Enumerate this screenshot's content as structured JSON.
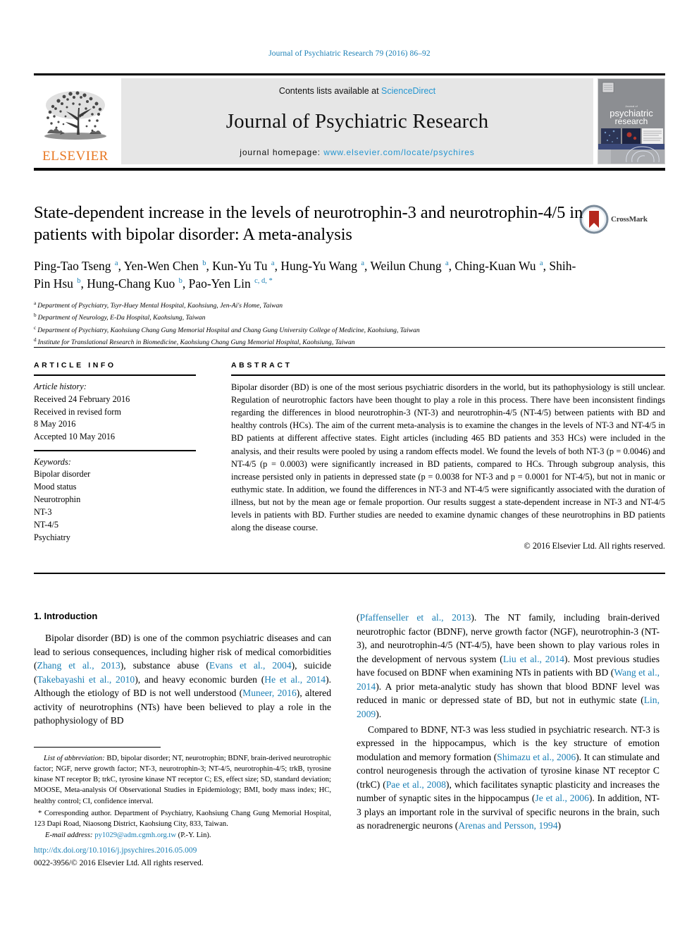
{
  "running_head": "Journal of Psychiatric Research 79 (2016) 86–92",
  "masthead": {
    "contents_prefix": "Contents lists available at ",
    "sciencedirect": "ScienceDirect",
    "journal_name": "Journal of Psychiatric Research",
    "homepage_label": "journal homepage: ",
    "homepage_url": "www.elsevier.com/locate/psychires",
    "publisher": "ELSEVIER",
    "cover_title_small": "Journal of",
    "cover_title_1": "psychiatric",
    "cover_title_2": "research"
  },
  "crossmark": {
    "label": "CrossMark"
  },
  "article": {
    "title": "State-dependent increase in the levels of neurotrophin-3 and neurotrophin-4/5 in patients with bipolar disorder: A meta-analysis",
    "authors": [
      {
        "name": "Ping-Tao Tseng",
        "marks": "a",
        "sep": ", "
      },
      {
        "name": "Yen-Wen Chen",
        "marks": "b",
        "sep": ", "
      },
      {
        "name": "Kun-Yu Tu",
        "marks": "a",
        "sep": ", "
      },
      {
        "name": "Hung-Yu Wang",
        "marks": "a",
        "sep": ", "
      },
      {
        "name": "Weilun Chung",
        "marks": "a",
        "sep": ", "
      },
      {
        "name": "Ching-Kuan Wu",
        "marks": "a",
        "sep": ", "
      },
      {
        "name": "Shih-Pin Hsu",
        "marks": "b",
        "sep": ", "
      },
      {
        "name": "Hung-Chang Kuo",
        "marks": "b",
        "sep": ", "
      },
      {
        "name": "Pao-Yen Lin",
        "marks": "c, d, *",
        "sep": ""
      }
    ],
    "affiliations": [
      {
        "mark": "a",
        "text": "Department of Psychiatry, Tsyr-Huey Mental Hospital, Kaohsiung, Jen-Ai's Home, Taiwan"
      },
      {
        "mark": "b",
        "text": "Department of Neurology, E-Da Hospital, Kaohsiung, Taiwan"
      },
      {
        "mark": "c",
        "text": "Department of Psychiatry, Kaohsiung Chang Gung Memorial Hospital and Chang Gung University College of Medicine, Kaohsiung, Taiwan"
      },
      {
        "mark": "d",
        "text": "Institute for Translational Research in Biomedicine, Kaohsiung Chang Gung Memorial Hospital, Kaohsiung, Taiwan"
      }
    ]
  },
  "article_info": {
    "heading": "ARTICLE INFO",
    "history_label": "Article history:",
    "history": [
      "Received 24 February 2016",
      "Received in revised form",
      "8 May 2016",
      "Accepted 10 May 2016"
    ],
    "keywords_label": "Keywords:",
    "keywords": [
      "Bipolar disorder",
      "Mood status",
      "Neurotrophin",
      "NT-3",
      "NT-4/5",
      "Psychiatry"
    ]
  },
  "abstract": {
    "heading": "ABSTRACT",
    "text": "Bipolar disorder (BD) is one of the most serious psychiatric disorders in the world, but its pathophysiology is still unclear. Regulation of neurotrophic factors have been thought to play a role in this process. There have been inconsistent findings regarding the differences in blood neurotrophin-3 (NT-3) and neurotrophin-4/5 (NT-4/5) between patients with BD and healthy controls (HCs). The aim of the current meta-analysis is to examine the changes in the levels of NT-3 and NT-4/5 in BD patients at different affective states. Eight articles (including 465 BD patients and 353 HCs) were included in the analysis, and their results were pooled by using a random effects model. We found the levels of both NT-3 (p = 0.0046) and NT-4/5 (p = 0.0003) were significantly increased in BD patients, compared to HCs. Through subgroup analysis, this increase persisted only in patients in depressed state (p = 0.0038 for NT-3 and p = 0.0001 for NT-4/5), but not in manic or euthymic state. In addition, we found the differences in NT-3 and NT-4/5 were significantly associated with the duration of illness, but not by the mean age or female proportion. Our results suggest a state-dependent increase in NT-3 and NT-4/5 levels in patients with BD. Further studies are needed to examine dynamic changes of these neurotrophins in BD patients along the disease course.",
    "copyright": "© 2016 Elsevier Ltd. All rights reserved."
  },
  "body": {
    "intro_heading": "1. Introduction",
    "left_paragraph_parts": [
      {
        "t": "Bipolar disorder (BD) is one of the common psychiatric diseases and can lead to serious consequences, including higher risk of medical comorbidities (",
        "link": false
      },
      {
        "t": "Zhang et al., 2013",
        "link": true
      },
      {
        "t": "), substance abuse (",
        "link": false
      },
      {
        "t": "Evans et al., 2004",
        "link": true
      },
      {
        "t": "), suicide (",
        "link": false
      },
      {
        "t": "Takebayashi et al., 2010",
        "link": true
      },
      {
        "t": "), and heavy economic burden (",
        "link": false
      },
      {
        "t": "He et al., 2014",
        "link": true
      },
      {
        "t": "). Although the etiology of BD is not well understood (",
        "link": false
      },
      {
        "t": "Muneer, 2016",
        "link": true
      },
      {
        "t": "), altered activity of neurotrophins (NTs) have been believed to play a role in the pathophysiology of BD",
        "link": false
      }
    ],
    "right_paragraph_1_parts": [
      {
        "t": "(",
        "link": false
      },
      {
        "t": "Pfaffenseller et al., 2013",
        "link": true
      },
      {
        "t": "). The NT family, including brain-derived neurotrophic factor (BDNF), nerve growth factor (NGF), neurotrophin-3 (NT-3), and neurotrophin-4/5 (NT-4/5), have been shown to play various roles in the development of nervous system (",
        "link": false
      },
      {
        "t": "Liu et al., 2014",
        "link": true
      },
      {
        "t": "). Most previous studies have focused on BDNF when examining NTs in patients with BD (",
        "link": false
      },
      {
        "t": "Wang et al., 2014",
        "link": true
      },
      {
        "t": "). A prior meta-analytic study has shown that blood BDNF level was reduced in manic or depressed state of BD, but not in euthymic state (",
        "link": false
      },
      {
        "t": "Lin, 2009",
        "link": true
      },
      {
        "t": ").",
        "link": false
      }
    ],
    "right_paragraph_2_parts": [
      {
        "t": "Compared to BDNF, NT-3 was less studied in psychiatric research. NT-3 is expressed in the hippocampus, which is the key structure of emotion modulation and memory formation (",
        "link": false
      },
      {
        "t": "Shimazu et al., 2006",
        "link": true
      },
      {
        "t": "). It can stimulate and control neurogenesis through the activation of tyrosine kinase NT receptor C (trkC) (",
        "link": false
      },
      {
        "t": "Pae et al., 2008",
        "link": true
      },
      {
        "t": "), which facilitates synaptic plasticity and increases the number of synaptic sites in the hippocampus (",
        "link": false
      },
      {
        "t": "Je et al., 2006",
        "link": true
      },
      {
        "t": "). In addition, NT-3 plays an important role in the survival of specific neurons in the brain, such as noradrenergic neurons (",
        "link": false
      },
      {
        "t": "Arenas and Persson, 1994",
        "link": true
      },
      {
        "t": ")",
        "link": false
      }
    ]
  },
  "footnotes": {
    "abbrev_label": "List of abbreviation:",
    "abbrev_text": " BD, bipolar disorder; NT, neurotrophin; BDNF, brain-derived neurotrophic factor; NGF, nerve growth factor; NT-3, neurotrophin-3; NT-4/5, neurotrophin-4/5; trkB, tyrosine kinase NT receptor B; trkC, tyrosine kinase NT receptor C; ES, effect size; SD, standard deviation; MOOSE, Meta-analysis Of Observational Studies in Epidemiology; BMI, body mass index; HC, healthy control; CI, confidence interval.",
    "corresponding": "* Corresponding author. Department of Psychiatry, Kaohsiung Chang Gung Memorial Hospital, 123 Dapi Road, Niaosong District, Kaohsiung City, 833, Taiwan.",
    "email_label": "E-mail address:",
    "email": "py1029@adm.cgmh.org.tw",
    "email_suffix": " (P.-Y. Lin).",
    "doi": "http://dx.doi.org/10.1016/j.jpsychires.2016.05.009",
    "issn": "0022-3956/© 2016 Elsevier Ltd. All rights reserved."
  },
  "colors": {
    "link_blue": "#1a7fb5",
    "elsevier_orange": "#E87722",
    "banner_gray": "#e6e6e6",
    "crossmark_red": "#b5281e"
  }
}
